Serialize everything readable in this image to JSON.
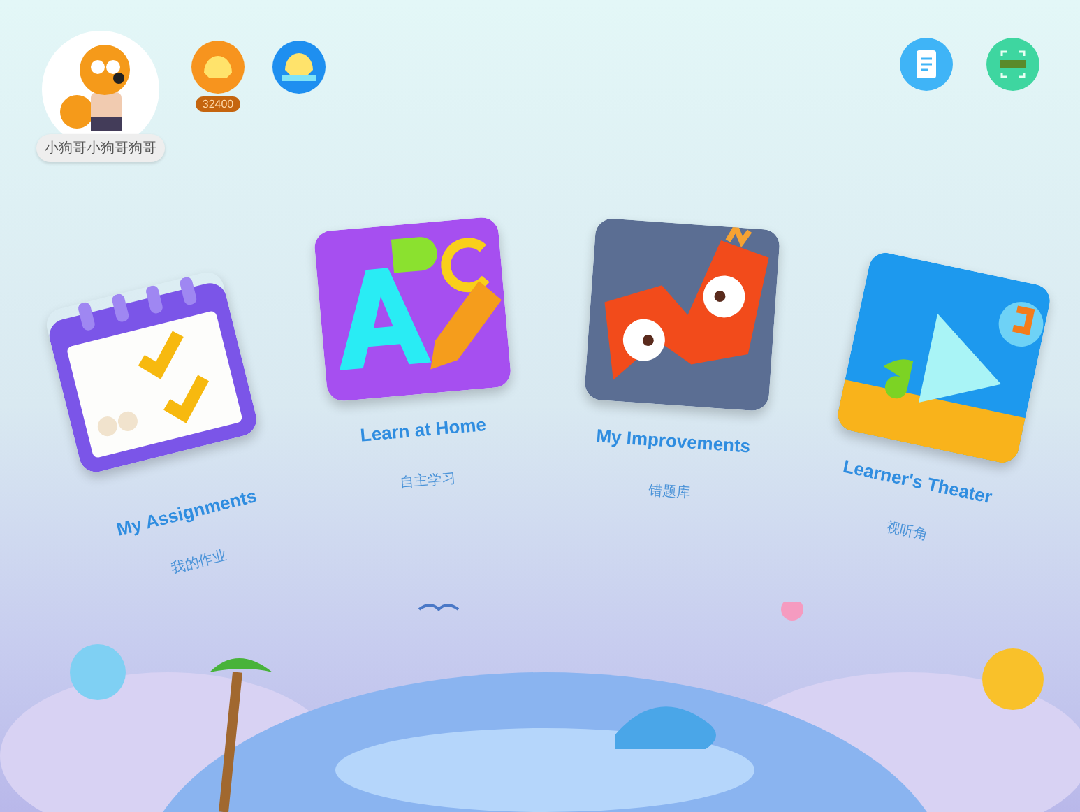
{
  "profile": {
    "name": "小狗哥小狗哥狗哥",
    "shells": "32400"
  },
  "tiles": [
    {
      "kind": "assignments",
      "title": "My Assignments",
      "subtitle": "我的作业"
    },
    {
      "kind": "abc",
      "title": "Learn at Home",
      "subtitle": "自主学习"
    },
    {
      "kind": "improve",
      "title": "My Improvements",
      "subtitle": "错题库"
    },
    {
      "kind": "theater",
      "title": "Learner's Theater",
      "subtitle": "视听角"
    }
  ]
}
